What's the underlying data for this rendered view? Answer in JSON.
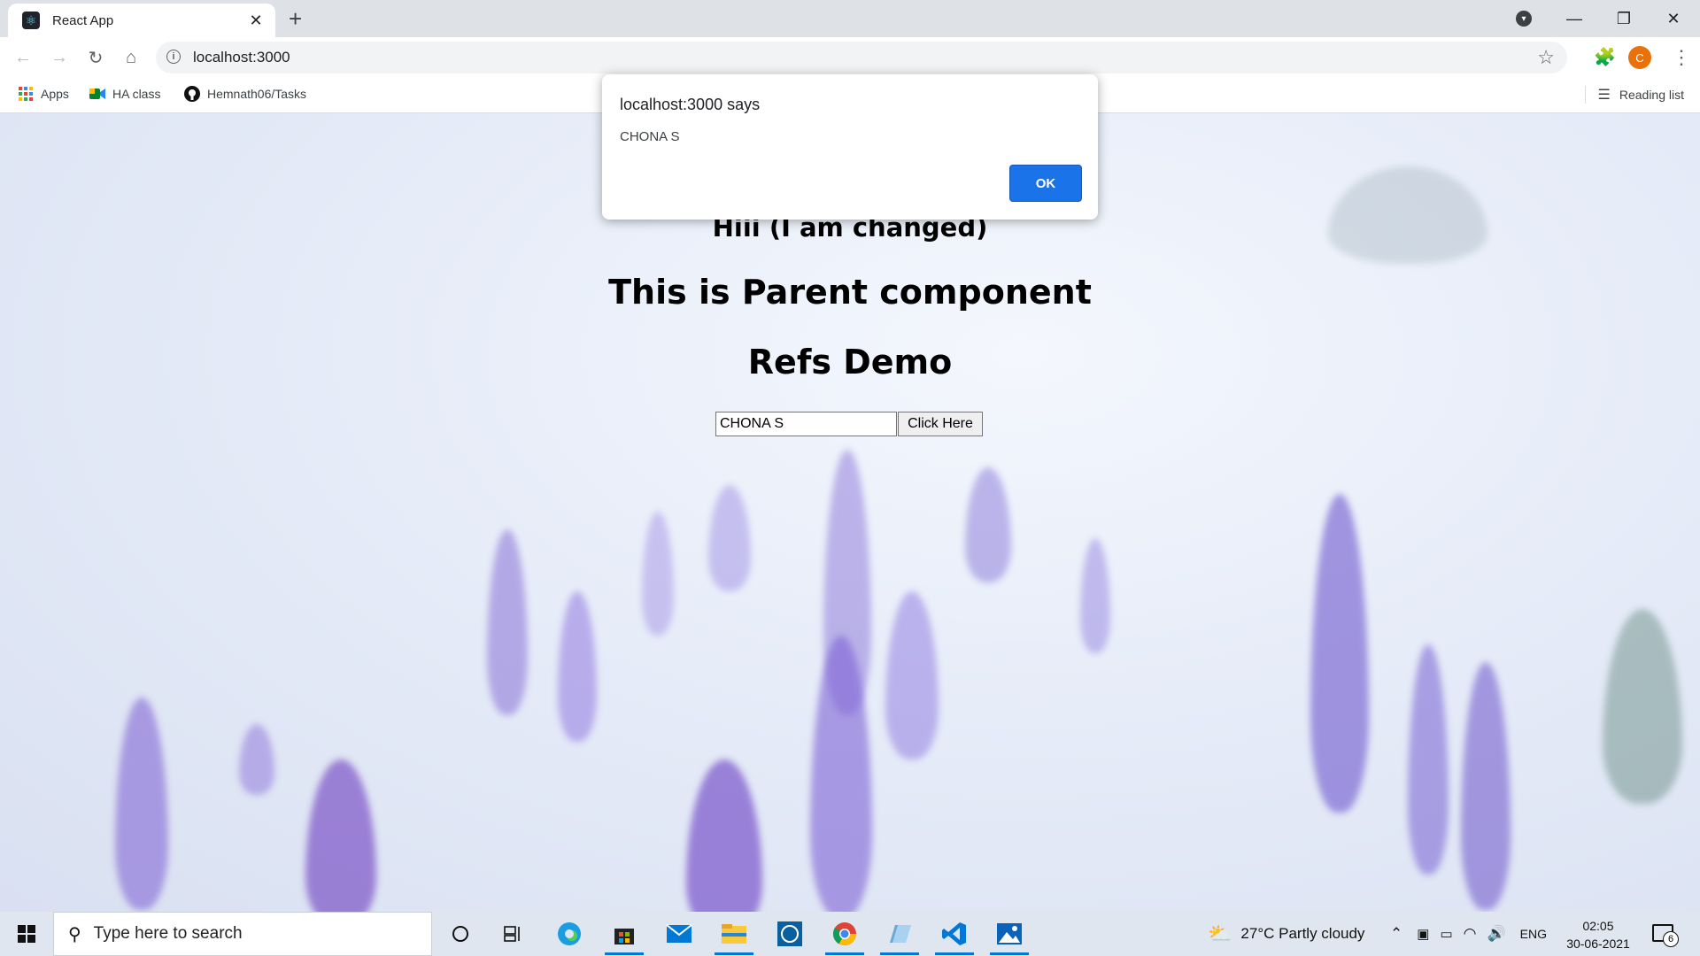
{
  "browser": {
    "tab_title": "React App",
    "new_tab_symbol": "+",
    "url": "localhost:3000",
    "bookmarks": [
      {
        "label": "Apps",
        "icon": "apps-grid-icon"
      },
      {
        "label": "HA class",
        "icon": "meet-icon"
      },
      {
        "label": "Hemnath06/Tasks",
        "icon": "github-icon"
      }
    ],
    "reading_list": "Reading list",
    "avatar_letter": "C"
  },
  "page": {
    "line1": "Hiii (I am changed)",
    "line2": "This is Parent component",
    "line3": "Refs Demo",
    "input_value": "CHONA S",
    "button_label": "Click Here"
  },
  "dialog": {
    "title": "localhost:3000 says",
    "message": "CHONA S",
    "ok_label": "OK",
    "ok_color": "#1a73e8"
  },
  "taskbar": {
    "search_placeholder": "Type here to search",
    "weather": "27°C  Partly cloudy",
    "language": "ENG",
    "time": "02:05",
    "date": "30-06-2021",
    "notification_count": "6",
    "accent": "#0078d4"
  }
}
